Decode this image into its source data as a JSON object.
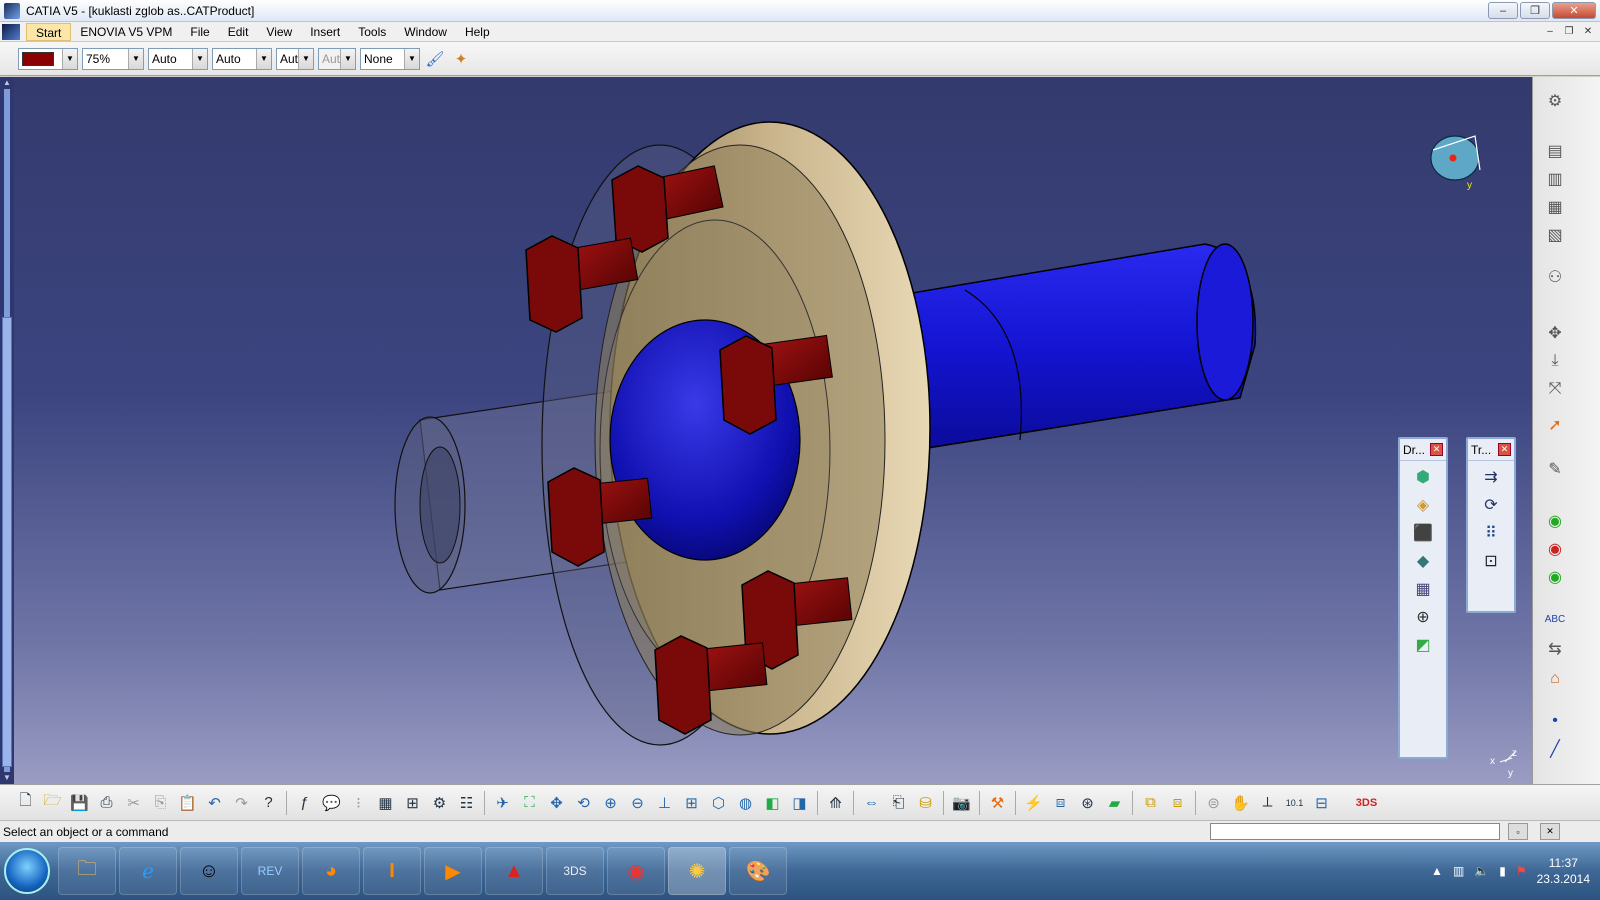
{
  "window": {
    "title": "CATIA V5 - [kuklasti zglob as..CATProduct]",
    "controls": [
      "–",
      "❐",
      "✕"
    ],
    "mdi_controls": [
      "–",
      "❐",
      "✕"
    ]
  },
  "menu": {
    "items": [
      "Start",
      "ENOVIA V5 VPM",
      "File",
      "Edit",
      "View",
      "Insert",
      "Tools",
      "Window",
      "Help"
    ]
  },
  "graphic_properties": {
    "color": "#8b0000",
    "transparency": "75%",
    "line_thickness": "Auto",
    "line_type": "Auto",
    "point_type": "Aut",
    "layer_disabled": "Aut",
    "rendering_style": "None"
  },
  "floating_toolbars": {
    "drafting": {
      "title": "Dr...",
      "icons": [
        "part-icon",
        "sheet-icon",
        "solid-icon",
        "cut-icon",
        "copy-icon",
        "target-icon",
        "paint-icon"
      ]
    },
    "transform": {
      "title": "Tr...",
      "icons": [
        "translate-icon",
        "rotate-icon",
        "grid-icon",
        "scale-icon"
      ]
    }
  },
  "status": {
    "message": "Select an object or a command",
    "command_input": ""
  },
  "taskbar": {
    "time": "11:37",
    "date": "23.3.2014",
    "apps": [
      "explorer",
      "internet-explorer",
      "people",
      "revit",
      "firefox",
      "inventor",
      "media-player",
      "autocad",
      "3ds",
      "chrome",
      "catia",
      "paint"
    ]
  },
  "compass": {
    "label_x": "x",
    "label_y": "y",
    "label_z": "z"
  },
  "colors": {
    "bolt": "#7a0a0a",
    "shaft": "#1414d2",
    "flange": "#c9b48c",
    "background_top": "#333a6d",
    "background_bottom": "#9a9cc3"
  }
}
